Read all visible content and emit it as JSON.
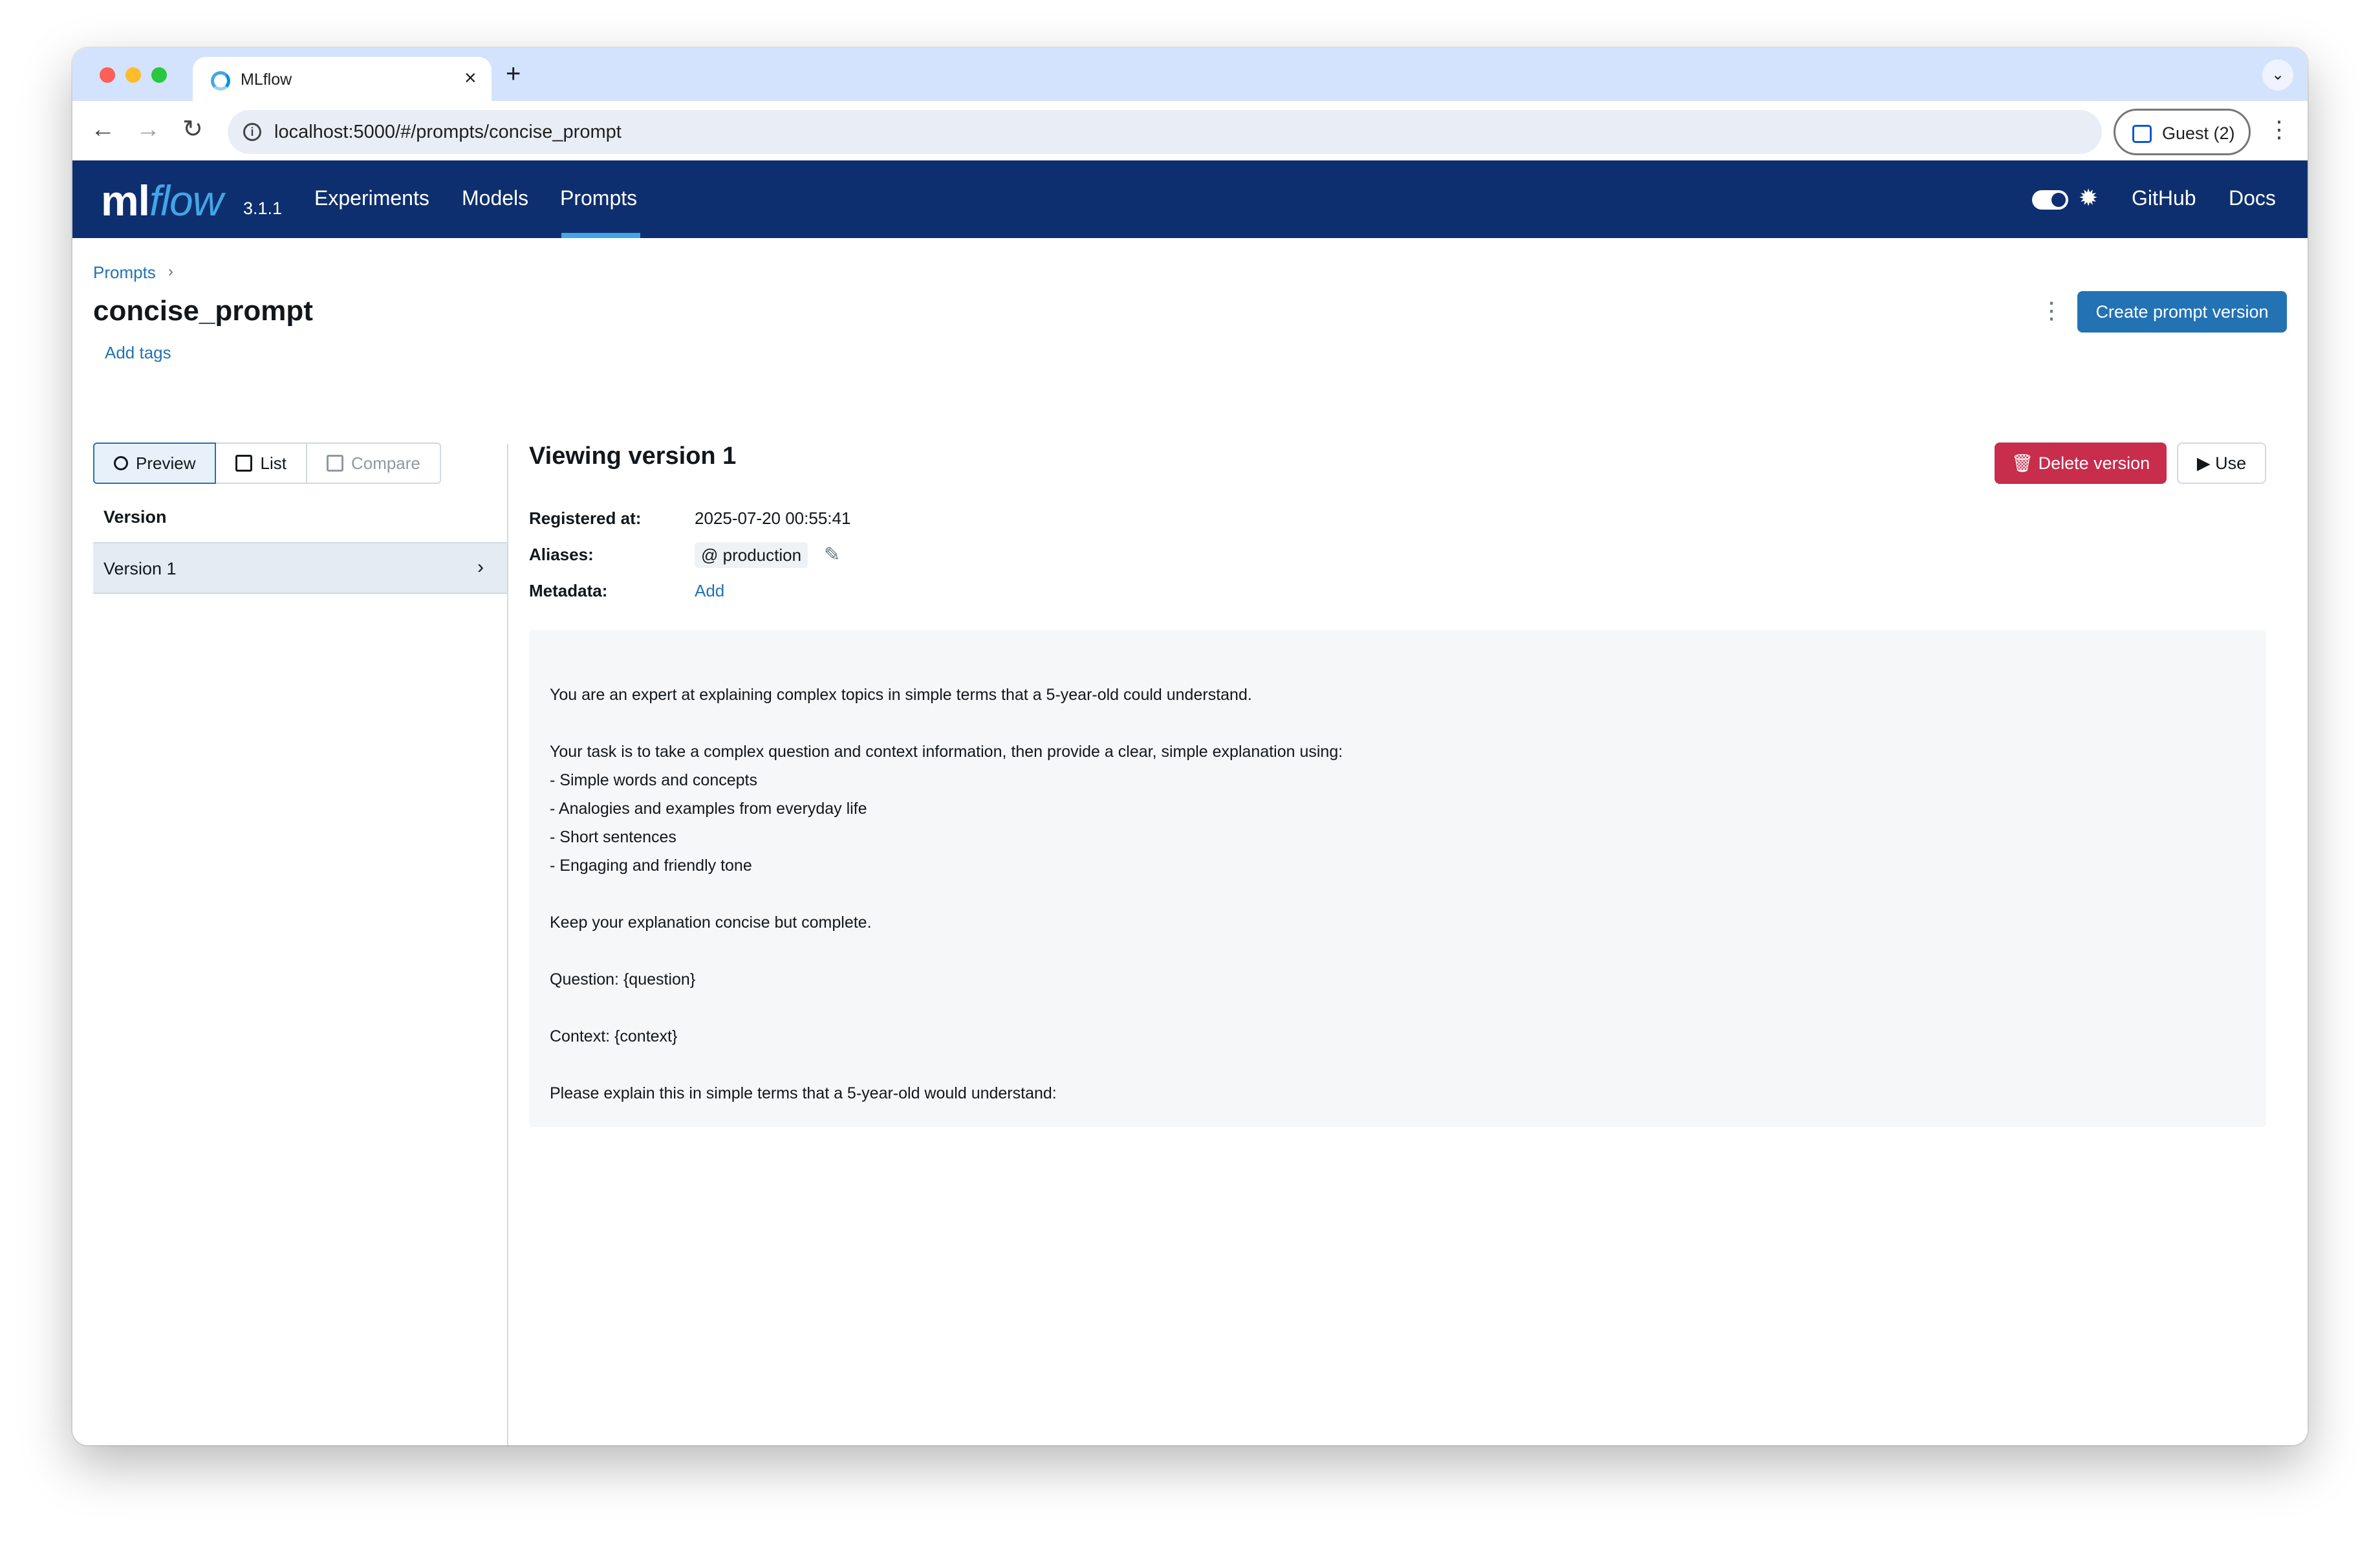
{
  "browser": {
    "tab_title": "MLflow",
    "url": "localhost:5000/#/prompts/concise_prompt",
    "profile_label": "Guest (2)"
  },
  "header": {
    "logo_ml": "ml",
    "logo_flow": "flow",
    "version": "3.1.1",
    "nav": {
      "experiments": "Experiments",
      "models": "Models",
      "prompts": "Prompts"
    },
    "github": "GitHub",
    "docs": "Docs"
  },
  "page": {
    "breadcrumb": "Prompts",
    "title": "concise_prompt",
    "add_tags": "Add tags",
    "create_button": "Create prompt version"
  },
  "left_panel": {
    "modes": {
      "preview": "Preview",
      "list": "List",
      "compare": "Compare"
    },
    "column_header": "Version",
    "versions": [
      {
        "label": "Version 1"
      }
    ]
  },
  "details": {
    "title": "Viewing version 1",
    "delete_button": "Delete version",
    "use_button": "Use",
    "registered_label": "Registered at:",
    "registered_value": "2025-07-20 00:55:41",
    "aliases_label": "Aliases:",
    "alias": "@ production",
    "metadata_label": "Metadata:",
    "metadata_add": "Add",
    "prompt_text": "You are an expert at explaining complex topics in simple terms that a 5-year-old could understand.\n\nYour task is to take a complex question and context information, then provide a clear, simple explanation using:\n- Simple words and concepts\n- Analogies and examples from everyday life\n- Short sentences\n- Engaging and friendly tone\n\nKeep your explanation concise but complete.\n\nQuestion: {question}\n\nContext: {context}\n\nPlease explain this in simple terms that a 5-year-old would understand:"
  },
  "colors": {
    "header_bg": "#0e2f6f",
    "accent": "#43a5e6",
    "primary": "#2272b4",
    "danger": "#c82d4c"
  }
}
